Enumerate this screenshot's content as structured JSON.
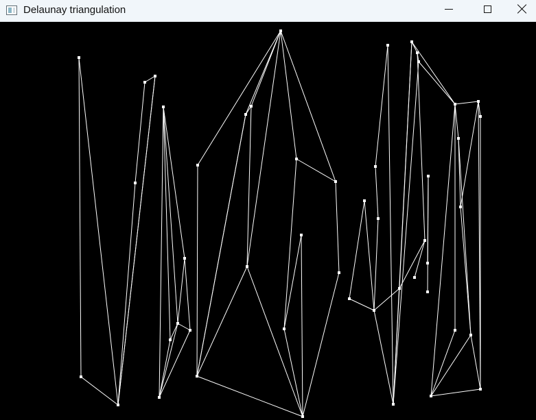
{
  "window": {
    "title": "Delaunay triangulation",
    "controls": [
      "minimize",
      "maximize",
      "close"
    ],
    "icon": "app-window-icon"
  },
  "canvas": {
    "background": "#000000",
    "point_color": "#ffffff",
    "edge_color": "#ffffff"
  },
  "chart_data": {
    "type": "scatter",
    "x": [
      115,
      118,
      172,
      211,
      226,
      197,
      238,
      232,
      248,
      259,
      269,
      277,
      288,
      287,
      358,
      366,
      360,
      409,
      432,
      439,
      441,
      414,
      489,
      494,
      509,
      531,
      547,
      551,
      545,
      565,
      573,
      582,
      600,
      608,
      610,
      619,
      624,
      623,
      623,
      604,
      663,
      668,
      671,
      697,
      700,
      686,
      663,
      700,
      628
    ],
    "y": [
      84,
      550,
      591,
      120,
      111,
      267,
      156,
      580,
      496,
      472,
      377,
      482,
      241,
      549,
      167,
      155,
      389,
      45,
      232,
      343,
      608,
      480,
      265,
      398,
      436,
      293,
      243,
      319,
      453,
      66,
      590,
      421,
      61,
      77,
      90,
      351,
      257,
      384,
      426,
      405,
      152,
      202,
      302,
      148,
      170,
      489,
      482,
      568,
      578
    ],
    "edges": [
      [
        0,
        1
      ],
      [
        0,
        2
      ],
      [
        1,
        2
      ],
      [
        2,
        5
      ],
      [
        2,
        4
      ],
      [
        5,
        3
      ],
      [
        3,
        4
      ],
      [
        4,
        2
      ],
      [
        6,
        7
      ],
      [
        6,
        8
      ],
      [
        6,
        10
      ],
      [
        7,
        8
      ],
      [
        7,
        9
      ],
      [
        7,
        11
      ],
      [
        8,
        9
      ],
      [
        9,
        10
      ],
      [
        9,
        11
      ],
      [
        10,
        11
      ],
      [
        6,
        9
      ],
      [
        12,
        13
      ],
      [
        12,
        17
      ],
      [
        13,
        14
      ],
      [
        13,
        16
      ],
      [
        13,
        20
      ],
      [
        14,
        15
      ],
      [
        14,
        17
      ],
      [
        15,
        16
      ],
      [
        15,
        17
      ],
      [
        16,
        17
      ],
      [
        16,
        20
      ],
      [
        17,
        18
      ],
      [
        17,
        22
      ],
      [
        18,
        22
      ],
      [
        18,
        21
      ],
      [
        19,
        21
      ],
      [
        19,
        20
      ],
      [
        20,
        23
      ],
      [
        22,
        23
      ],
      [
        20,
        21
      ],
      [
        14,
        13
      ],
      [
        24,
        25
      ],
      [
        24,
        28
      ],
      [
        25,
        28
      ],
      [
        26,
        27
      ],
      [
        26,
        29
      ],
      [
        28,
        27
      ],
      [
        28,
        30
      ],
      [
        28,
        31
      ],
      [
        29,
        30
      ],
      [
        30,
        31
      ],
      [
        31,
        32
      ],
      [
        31,
        35
      ],
      [
        32,
        33
      ],
      [
        32,
        30
      ],
      [
        33,
        34
      ],
      [
        34,
        30
      ],
      [
        34,
        40
      ],
      [
        32,
        40
      ],
      [
        35,
        33
      ],
      [
        35,
        39
      ],
      [
        36,
        38
      ],
      [
        37,
        36
      ],
      [
        40,
        41
      ],
      [
        40,
        43
      ],
      [
        40,
        46
      ],
      [
        40,
        48
      ],
      [
        41,
        42
      ],
      [
        41,
        45
      ],
      [
        42,
        45
      ],
      [
        43,
        44
      ],
      [
        43,
        47
      ],
      [
        44,
        47
      ],
      [
        45,
        47
      ],
      [
        45,
        48
      ],
      [
        46,
        48
      ],
      [
        47,
        48
      ],
      [
        42,
        43
      ]
    ]
  }
}
